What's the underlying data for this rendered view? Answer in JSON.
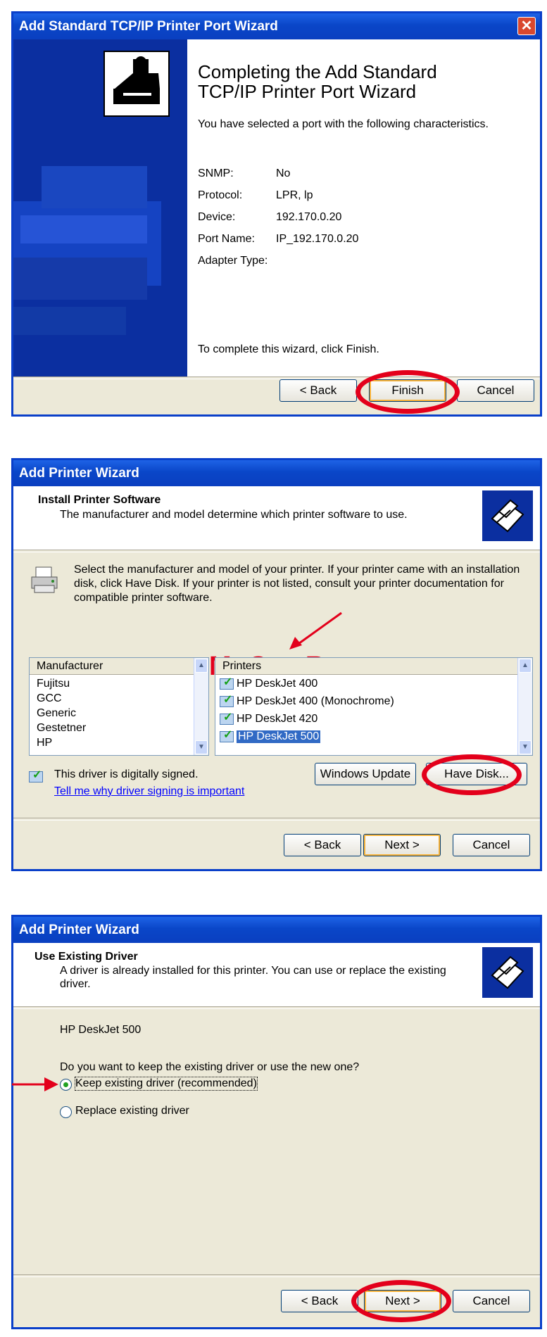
{
  "w1": {
    "title": "Add Standard TCP/IP Printer Port Wizard",
    "close": "✕",
    "heading_line1": "Completing the Add Standard",
    "heading_line2": "TCP/IP Printer Port Wizard",
    "intro": "You have selected a port with the following characteristics.",
    "fields": [
      {
        "label": "SNMP:",
        "value": "No"
      },
      {
        "label": "Protocol:",
        "value": "LPR, lp"
      },
      {
        "label": "Device:",
        "value": "192.170.0.20"
      },
      {
        "label": "Port Name:",
        "value": "IP_192.170.0.20"
      },
      {
        "label": "Adapter Type:",
        "value": ""
      }
    ],
    "footer_text": "To complete this wizard, click Finish.",
    "back": "< Back",
    "finish": "Finish",
    "cancel": "Cancel"
  },
  "w2": {
    "title": "Add Printer Wizard",
    "header_title": "Install Printer Software",
    "header_sub": "The manufacturer and model determine which printer software to use.",
    "desc": "Select the manufacturer and model of your printer. If your printer came with an installation disk, click Have Disk. If your printer is not listed, consult your printer documentation for compatible printer software.",
    "manufacturer_header": "Manufacturer",
    "manufacturers": [
      "Fujitsu",
      "GCC",
      "Generic",
      "Gestetner",
      "HP"
    ],
    "selected_manufacturer": "HP",
    "printers_header": "Printers",
    "printers": [
      "HP DeskJet 400",
      "HP DeskJet 400 (Monochrome)",
      "HP DeskJet 420",
      "HP DeskJet 500"
    ],
    "selected_printer": "HP DeskJet 500",
    "signed_text": "This driver is digitally signed.",
    "signing_link": "Tell me why driver signing is important",
    "windows_update": "Windows Update",
    "have_disk": "Have Disk...",
    "back": "< Back",
    "next": "Next >",
    "cancel": "Cancel",
    "watermark": "McGrp.Ru"
  },
  "w3": {
    "title": "Add Printer Wizard",
    "header_title": "Use Existing Driver",
    "header_sub": "A driver is already installed for this printer. You can use or replace the existing driver.",
    "printer_name": "HP DeskJet 500",
    "question": "Do you want to keep the existing driver or use the new one?",
    "option_keep": "Keep existing driver (recommended)",
    "option_replace": "Replace existing driver",
    "selected_option": "keep",
    "back": "< Back",
    "next": "Next >",
    "cancel": "Cancel"
  },
  "colors": {
    "titlebar": "#0a46c8",
    "wizard_blue": "#0b2fa0",
    "highlight_circle": "#e3001b",
    "selection": "#316ac5"
  }
}
